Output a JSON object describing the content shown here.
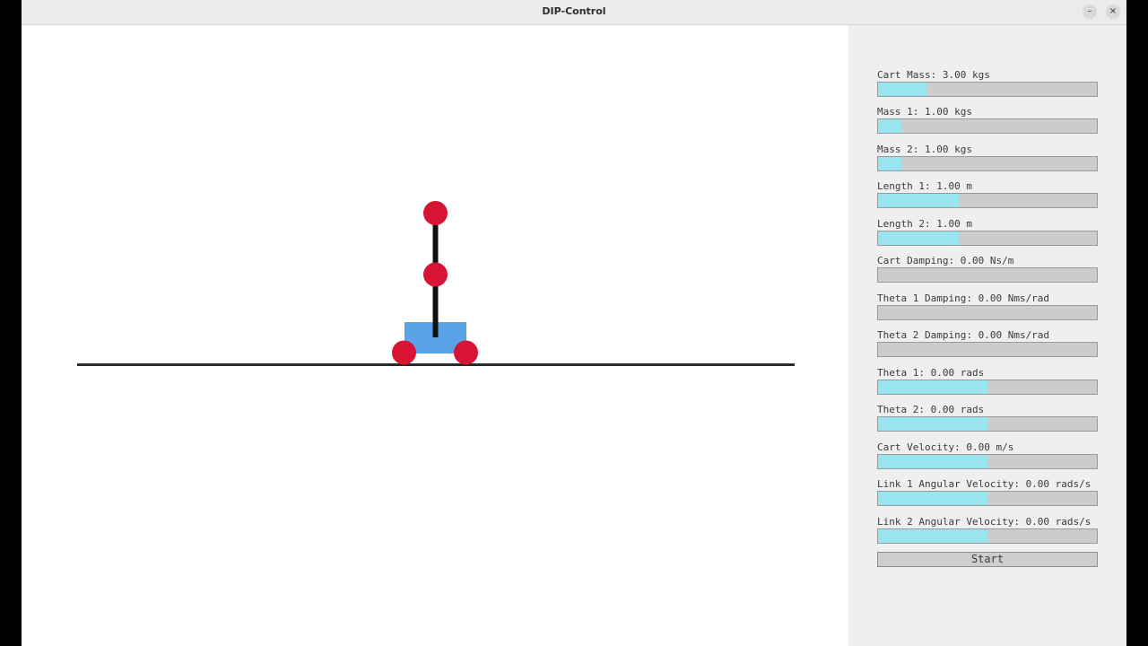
{
  "window": {
    "title": "DIP-Control",
    "minimize_glyph": "–",
    "close_glyph": "×"
  },
  "colors": {
    "cart": "#5aa3e8",
    "mass": "#d71434",
    "rod": "#111111",
    "track": "#2b2b2b",
    "slider_fill": "#99e5ef",
    "slider_track": "#cccccc",
    "panel_bg": "#efefef"
  },
  "sliders": [
    {
      "label": "Cart Mass: 3.00 kgs",
      "fill": 0.22
    },
    {
      "label": "Mass 1: 1.00 kgs",
      "fill": 0.11
    },
    {
      "label": "Mass 2: 1.00 kgs",
      "fill": 0.11
    },
    {
      "label": "Length 1: 1.00 m",
      "fill": 0.37
    },
    {
      "label": "Length 2: 1.00 m",
      "fill": 0.37
    },
    {
      "label": "Cart Damping: 0.00 Ns/m",
      "fill": 0.0
    },
    {
      "label": "Theta 1 Damping: 0.00 Nms/rad",
      "fill": 0.0
    },
    {
      "label": "Theta 2 Damping: 0.00 Nms/rad",
      "fill": 0.0
    },
    {
      "label": "Theta 1: 0.00 rads",
      "fill": 0.5
    },
    {
      "label": "Theta 2: 0.00 rads",
      "fill": 0.5
    },
    {
      "label": "Cart Velocity: 0.00 m/s",
      "fill": 0.5
    },
    {
      "label": "Link 1 Angular Velocity: 0.00 rads/s",
      "fill": 0.5
    },
    {
      "label": "Link 2 Angular Velocity: 0.00 rads/s",
      "fill": 0.5
    }
  ],
  "start_label": "Start"
}
